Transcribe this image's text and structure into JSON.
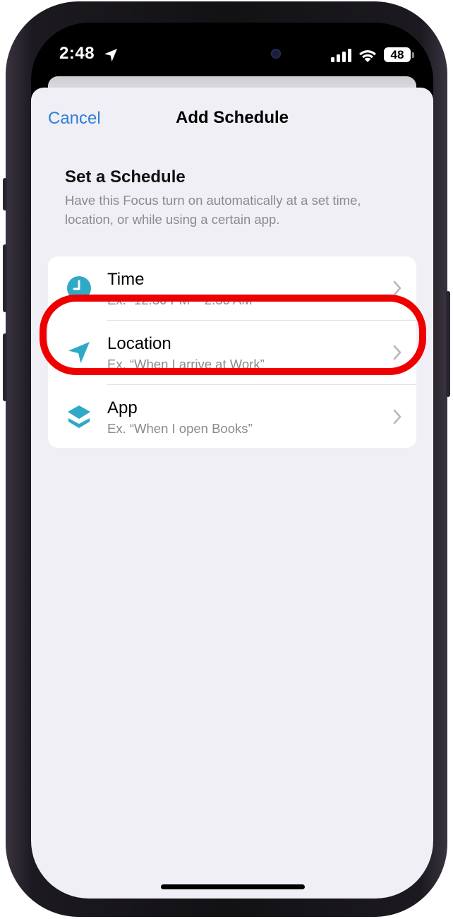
{
  "status_bar": {
    "time": "2:48",
    "battery": "48",
    "location_icon": "location-arrow-icon",
    "signal_icon": "cellular-signal-icon",
    "wifi_icon": "wifi-icon"
  },
  "nav": {
    "cancel_label": "Cancel",
    "title": "Add Schedule"
  },
  "section": {
    "heading": "Set a Schedule",
    "description": "Have this Focus turn on automatically at a set time, location, or while using a certain app."
  },
  "options": [
    {
      "title": "Time",
      "subtitle": "Ex. “12:30 PM – 2:30 AM”",
      "icon": "clock-icon"
    },
    {
      "title": "Location",
      "subtitle": "Ex. “When I arrive at Work”",
      "icon": "location-arrow-icon"
    },
    {
      "title": "App",
      "subtitle": "Ex. “When I open Books”",
      "icon": "stack-layers-icon"
    }
  ],
  "colors": {
    "accent": "#2f7fd6",
    "icon_teal": "#2fa9c6",
    "highlight": "#ee0000",
    "sheet_background": "#f0eff5"
  }
}
